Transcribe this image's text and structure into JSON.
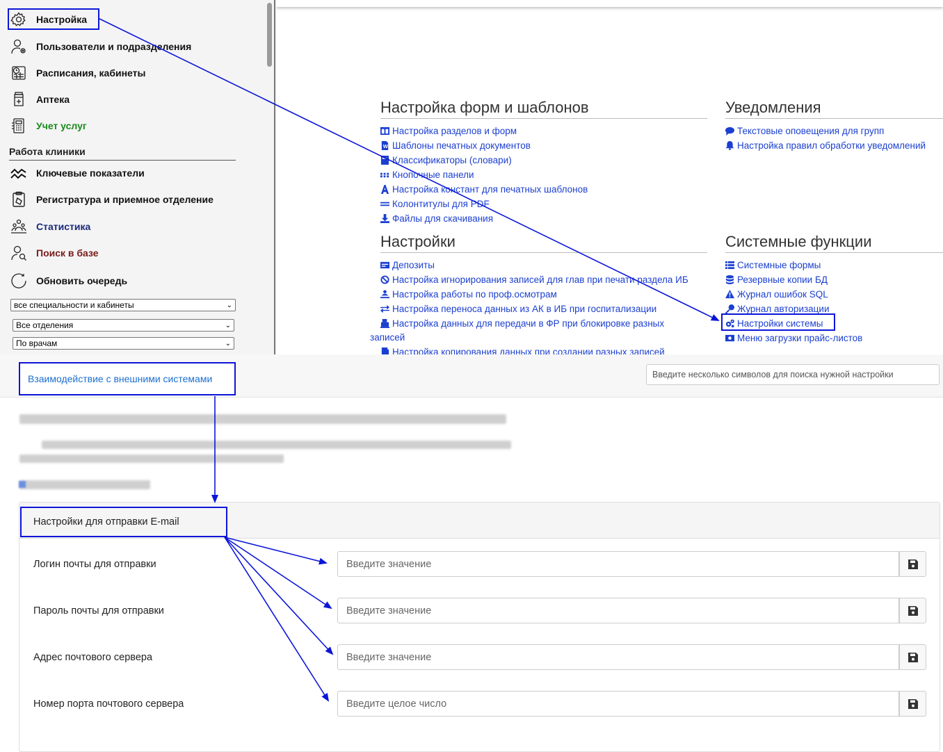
{
  "sidebar": {
    "items": [
      {
        "label": "Настройка",
        "icon": "gear-icon"
      },
      {
        "label": "Пользователи и подразделения",
        "icon": "user-gear-icon"
      },
      {
        "label": "Расписания, кабинеты",
        "icon": "calendar-clock-icon"
      },
      {
        "label": "Аптека",
        "icon": "pharmacy-jar-icon"
      },
      {
        "label": "Учет услуг",
        "icon": "calculator-icon"
      }
    ],
    "section_title": "Работа клиники",
    "clinic_items": [
      {
        "label": "Ключевые показатели",
        "icon": "trend-chart-icon"
      },
      {
        "label": "Регистратура и приемное отделение",
        "icon": "clipboard-icon"
      },
      {
        "label": "Статистика",
        "icon": "stats-people-icon"
      },
      {
        "label": "Поиск в базе",
        "icon": "user-search-icon"
      },
      {
        "label": "Обновить очередь",
        "icon": "refresh-circle-icon"
      }
    ],
    "filters": {
      "specialties": "все специальности и кабинеты",
      "departments": "Все отделения",
      "doctors": "По врачам"
    }
  },
  "settings": {
    "forms": {
      "title": "Настройка форм и шаблонов",
      "links": [
        {
          "label": "Настройка разделов и форм",
          "icon": "columns-icon"
        },
        {
          "label": "Шаблоны печатных документов",
          "icon": "word-file-icon"
        },
        {
          "label": "Классификаторы (словари)",
          "icon": "book-icon"
        },
        {
          "label": "Кнопочные панели",
          "icon": "grid-dots-icon"
        },
        {
          "label": "Настройка констант для печатных шаблонов",
          "icon": "letter-a-icon"
        },
        {
          "label": "Колонтитулы для PDF",
          "icon": "equals-icon"
        },
        {
          "label": "Файлы для скачивания",
          "icon": "download-icon"
        }
      ]
    },
    "notifications": {
      "title": "Уведомления",
      "links": [
        {
          "label": "Текстовые оповещения для групп",
          "icon": "comment-icon"
        },
        {
          "label": "Настройка правил обработки уведомлений",
          "icon": "bell-icon"
        }
      ]
    },
    "settings": {
      "title": "Настройки",
      "links": [
        {
          "label": "Депозиты",
          "icon": "money-icon"
        },
        {
          "label": "Настройка игнорирования записей для глав при печати раздела ИБ",
          "icon": "ban-icon"
        },
        {
          "label": "Настройка работы по проф.осмотрам",
          "icon": "person-check-icon"
        },
        {
          "label": "Настройка переноса данных из АК в ИБ при госпитализации",
          "icon": "exchange-icon"
        },
        {
          "label": "Настройка данных для передачи в ФР при блокировке разных",
          "icon": "bank-icon"
        },
        {
          "label": "записей",
          "icon": ""
        },
        {
          "label": "Настройка копирования данных при создании разных записей",
          "icon": "copy-icon"
        }
      ]
    },
    "system": {
      "title": "Системные функции",
      "links": [
        {
          "label": "Системные формы",
          "icon": "list-icon"
        },
        {
          "label": "Резервные копии БД",
          "icon": "database-icon"
        },
        {
          "label": "Журнал ошибок SQL",
          "icon": "warning-icon"
        },
        {
          "label": "Журнал авторизации",
          "icon": "key-icon"
        },
        {
          "label": "Настройки системы",
          "icon": "cogs-icon"
        },
        {
          "label": "Меню загрузки прайс-листов",
          "icon": "money-bill-icon"
        }
      ]
    }
  },
  "bottom": {
    "tab_label": "Взаимодействие с внешними системами",
    "search_placeholder": "Введите несколько символов для поиска нужной настройки",
    "panel_title": "Настройки для отправки E-mail",
    "rows": [
      {
        "label": "Логин почты для отправки",
        "placeholder": "Введите значение"
      },
      {
        "label": "Пароль почты для отправки",
        "placeholder": "Введите значение"
      },
      {
        "label": "Адрес почтового сервера",
        "placeholder": "Введите значение"
      },
      {
        "label": "Номер порта почтового сервера",
        "placeholder": "Введите целое число"
      }
    ]
  },
  "colors": {
    "annotation": "#0b15d8",
    "link": "#1b3fd0",
    "tab_link": "#1b6fd0"
  }
}
